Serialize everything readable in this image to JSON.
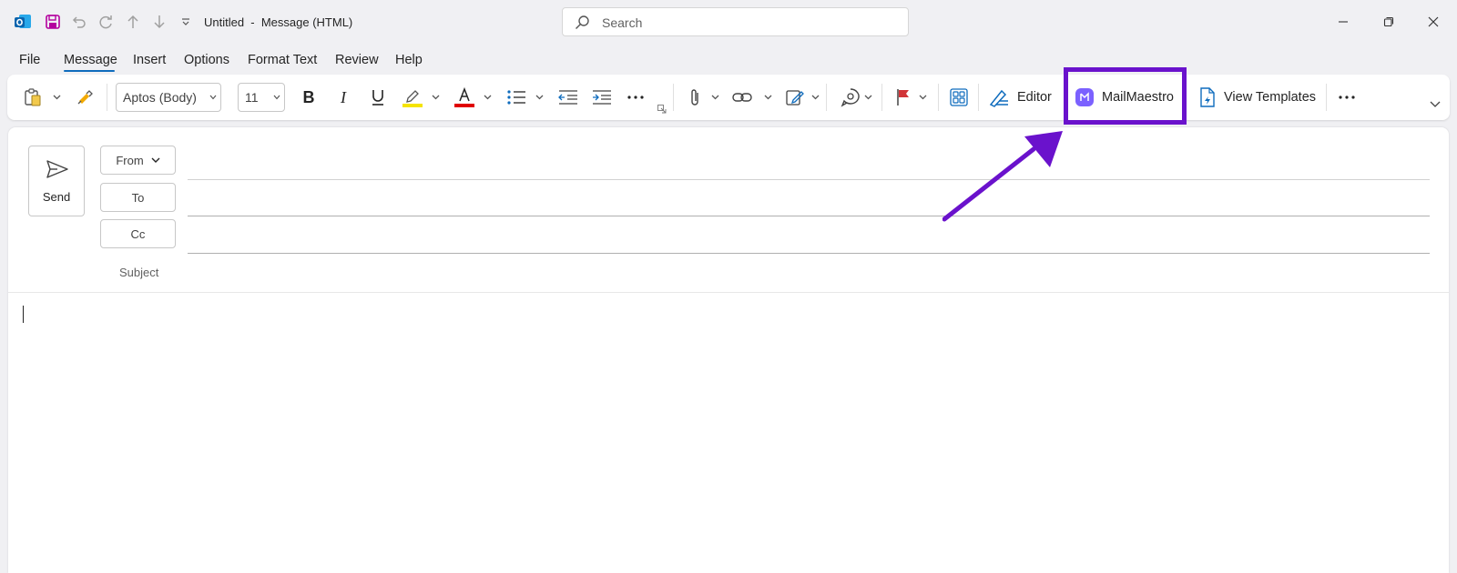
{
  "window": {
    "title": "Untitled  -  Message (HTML)",
    "search_placeholder": "Search"
  },
  "menu": {
    "tabs": [
      "File",
      "Message",
      "Insert",
      "Options",
      "Format Text",
      "Review",
      "Help"
    ],
    "active": "Message"
  },
  "ribbon": {
    "font_name": "Aptos (Body)",
    "font_size": "11",
    "editor_label": "Editor",
    "mailmaestro_label": "MailMaestro",
    "view_templates_label": "View Templates",
    "highlight_color": "#f5e400",
    "font_color": "#e00000",
    "annotation_color": "#6a12cc"
  },
  "compose": {
    "send_label": "Send",
    "from_label": "From",
    "to_label": "To",
    "cc_label": "Cc",
    "subject_label": "Subject",
    "to_value": "",
    "cc_value": "",
    "subject_value": "",
    "body_text": ""
  }
}
